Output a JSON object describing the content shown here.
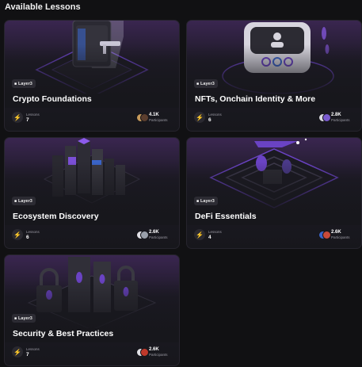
{
  "page": {
    "title": "Available Lessons"
  },
  "labels": {
    "lessons": "Lessons",
    "participants": "Participants"
  },
  "badge": {
    "label": "Layer3",
    "icon": "layer3-logo-icon"
  },
  "lessons": [
    {
      "title": "Crypto Foundations",
      "lesson_count": "7",
      "participants": "4.1K",
      "art_icon": "lock-safe-illustration"
    },
    {
      "title": "NFTs, Onchain Identity & More",
      "lesson_count": "6",
      "participants": "2.8K",
      "art_icon": "identity-card-illustration"
    },
    {
      "title": "Ecosystem Discovery",
      "lesson_count": "6",
      "participants": "2.6K",
      "art_icon": "isometric-city-illustration"
    },
    {
      "title": "DeFi Essentials",
      "lesson_count": "4",
      "participants": "2.6K",
      "art_icon": "maze-coins-illustration"
    },
    {
      "title": "Security & Best Practices",
      "lesson_count": "7",
      "participants": "2.6K",
      "art_icon": "padlocks-illustration"
    }
  ],
  "colors": {
    "background": "#111113",
    "card": "#17171c",
    "accent": "#7b4fd6"
  }
}
